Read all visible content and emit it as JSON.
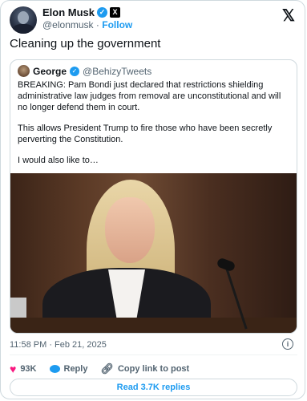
{
  "author": {
    "name": "Elon Musk",
    "handle": "@elonmusk",
    "separator": "·",
    "follow_label": "Follow"
  },
  "platform_logo": "𝕏",
  "tweet": {
    "text": "Cleaning up the government",
    "timestamp": "11:58 PM · Feb 21, 2025"
  },
  "quote": {
    "name": "George",
    "handle": "@BehizyTweets",
    "paragraphs": [
      "BREAKING: Pam Bondi just declared that restrictions shielding administrative law judges from removal are unconstitutional and will no longer defend them in court.",
      "This allows President Trump to fire those who have been secretly perverting the Constitution.",
      "I would also like to…"
    ]
  },
  "actions": {
    "likes": "93K",
    "reply_label": "Reply",
    "copy_label": "Copy link to post"
  },
  "read_replies_label": "Read 3.7K replies",
  "icons": {
    "verified": "verified-check-icon",
    "info": "info-icon",
    "like": "heart-icon",
    "reply": "reply-bubble-icon",
    "link": "link-icon"
  },
  "colors": {
    "accent": "#1d9bf0",
    "like": "#f91880",
    "muted": "#536471"
  }
}
